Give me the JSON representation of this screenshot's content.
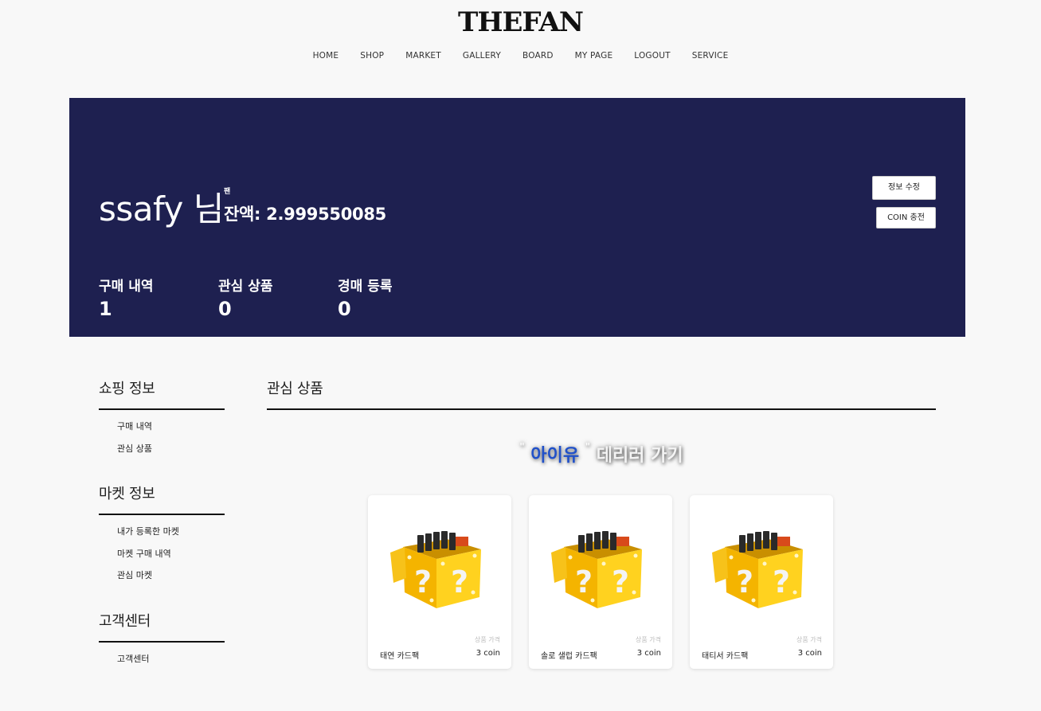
{
  "header": {
    "logo": "THEFAN",
    "nav": [
      "HOME",
      "SHOP",
      "MARKET",
      "GALLERY",
      "BOARD",
      "MY PAGE",
      "LOGOUT",
      "SERVICE"
    ]
  },
  "profile": {
    "username": "ssafy 님",
    "badge": "팬",
    "balance": "잔액: 2.999550085",
    "edit_label": "정보 수정",
    "coin_label": "COIN 충전",
    "stats": [
      {
        "label": "구매 내역",
        "value": "1"
      },
      {
        "label": "관심 상품",
        "value": "0"
      },
      {
        "label": "경매 등록",
        "value": "0"
      }
    ]
  },
  "sidebar": {
    "groups": [
      {
        "title": "쇼핑 정보",
        "items": [
          "구매 내역",
          "관심 상품"
        ]
      },
      {
        "title": "마켓 정보",
        "items": [
          "내가 등록한 마켓",
          "마켓 구매 내역",
          "관심 마켓"
        ]
      },
      {
        "title": "고객센터",
        "items": [
          "고객센터"
        ]
      }
    ]
  },
  "main": {
    "title": "관심 상품",
    "promo": {
      "open_quote": "\"",
      "artist": "아이유",
      "close_quote": "\"",
      "text": "데리러 가기"
    },
    "products": [
      {
        "name": "태연 카드팩",
        "price_label": "상품 가격",
        "price": "3 coin",
        "icon": "mystery-box-icon"
      },
      {
        "name": "솔로 샐럽 카드팩",
        "price_label": "상품 가격",
        "price": "3 coin",
        "icon": "mystery-box-icon"
      },
      {
        "name": "태티서 카드팩",
        "price_label": "상품 가격",
        "price": "3 coin",
        "icon": "mystery-box-icon"
      }
    ]
  },
  "colors": {
    "hero_bg": "#1e2050",
    "page_bg": "#f8f8f8",
    "artist_accent": "#2151c9",
    "box_yellow": "#f5c518"
  }
}
